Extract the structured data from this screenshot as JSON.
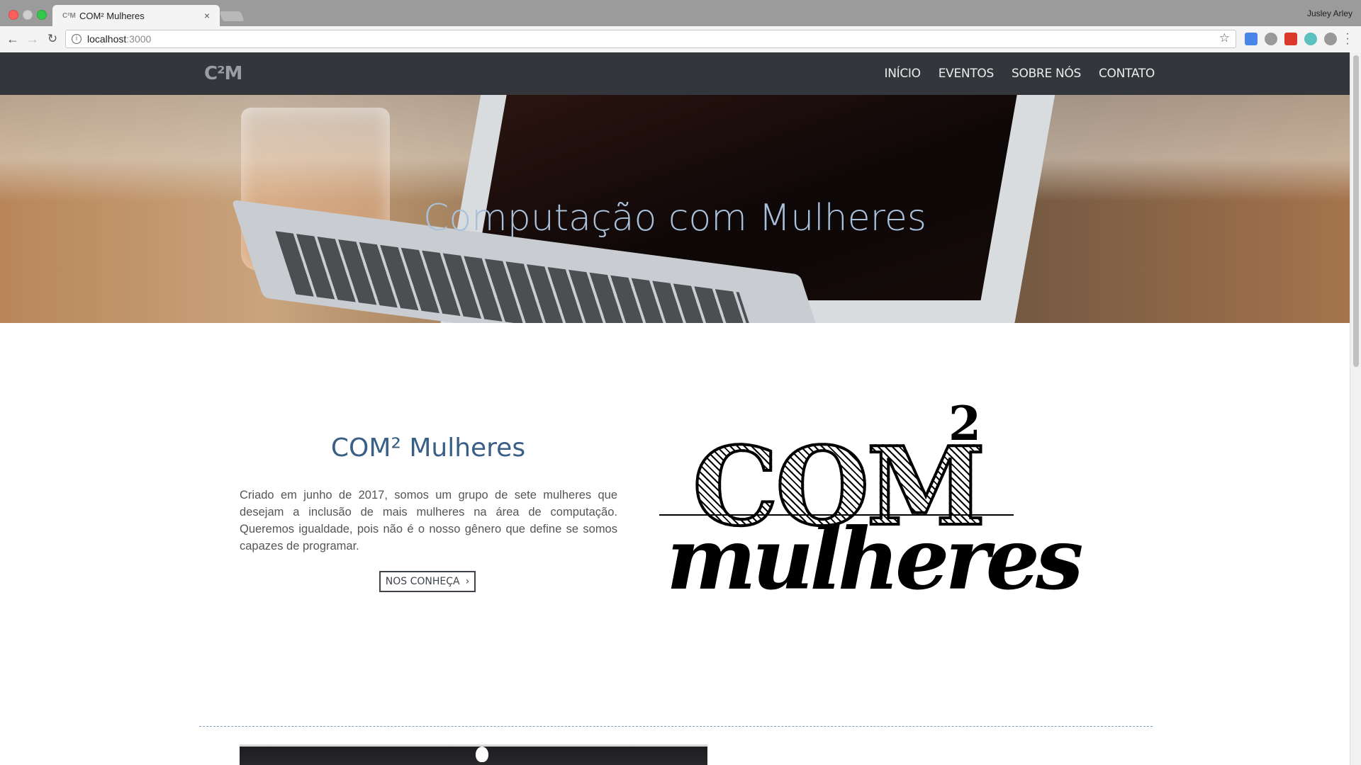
{
  "browser": {
    "tab_title": "COM² Mulheres",
    "tab_favicon": "C²M",
    "tab_close": "×",
    "profile_name": "Jusley Arley",
    "url_host": "localhost",
    "url_port": ":3000",
    "icons": {
      "back": "back-arrow-icon",
      "forward": "forward-arrow-icon",
      "reload": "reload-icon",
      "info": "info-icon",
      "bookmark": "star-icon",
      "menu": "kebab-menu-icon"
    }
  },
  "site": {
    "logo": "C²M",
    "nav": [
      {
        "label": "INÍCIO"
      },
      {
        "label": "EVENTOS"
      },
      {
        "label": "SOBRE NÓS"
      },
      {
        "label": "CONTATO"
      }
    ]
  },
  "hero": {
    "title": "Computação com Mulheres"
  },
  "about": {
    "title": "COM² Mulheres",
    "text": "Criado em junho de 2017, somos um grupo de sete mulheres que desejam a inclusão de mais mulheres na área de computação. Queremos igualdade, pois não é o nosso gênero que define se somos capazes de programar.",
    "button_label": "NOS CONHEÇA",
    "button_icon": "›",
    "logo_com": "COM",
    "logo_sup": "2",
    "logo_mulheres": "mulheres"
  },
  "colors": {
    "nav_bg": "#33373c",
    "hero_title": "#a9c0da",
    "about_title": "#3a5f87",
    "divider": "#7e9fbf"
  }
}
